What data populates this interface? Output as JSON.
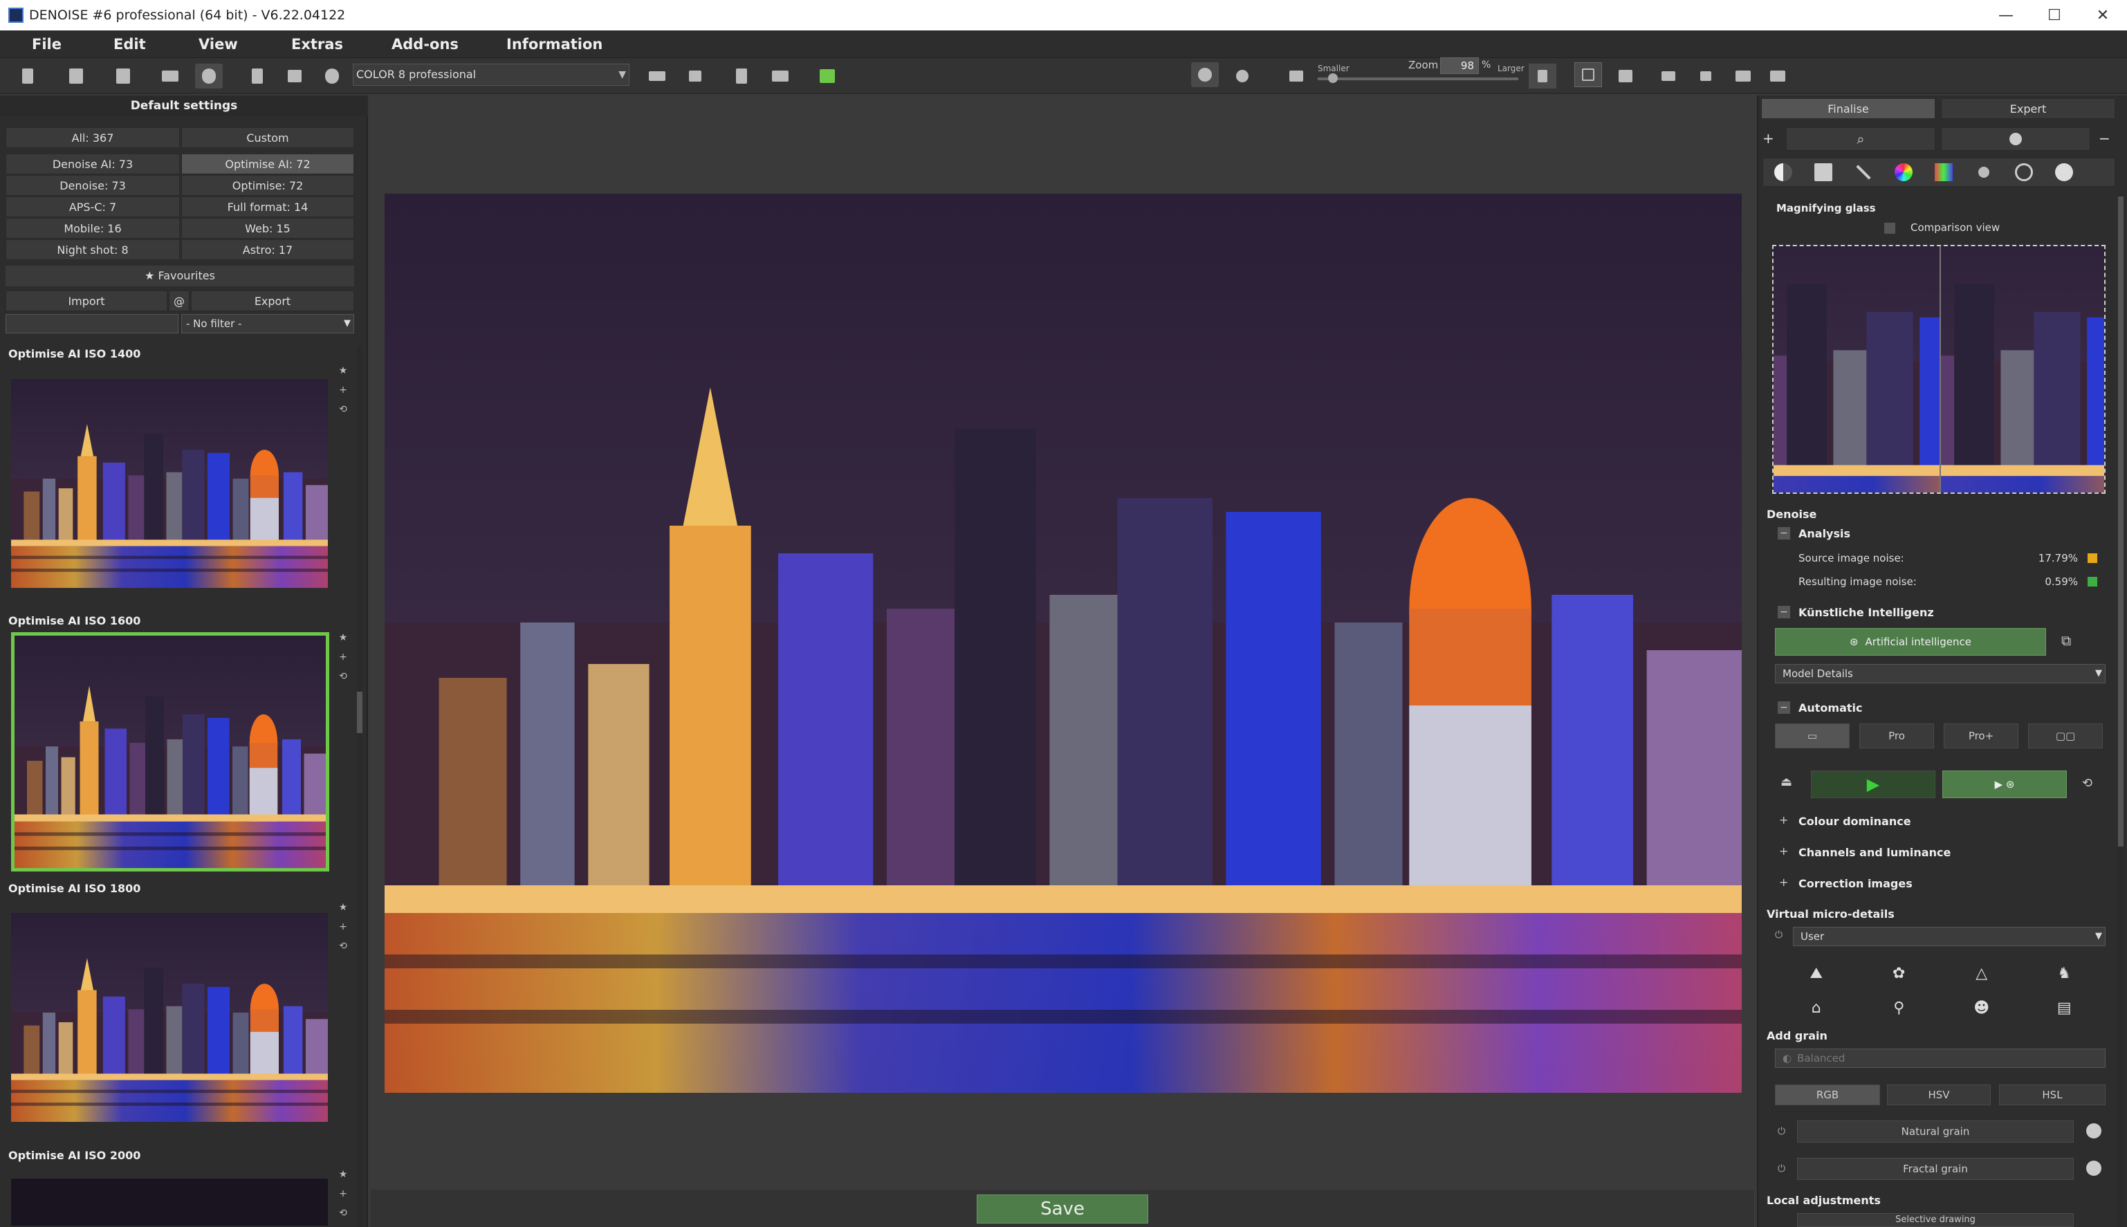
{
  "window": {
    "title": "DENOISE #6 professional (64 bit) - V6.22.04122",
    "controls": [
      "—",
      "☐",
      "✕"
    ]
  },
  "menu": [
    "File",
    "Edit",
    "View",
    "Extras",
    "Add-ons",
    "Information"
  ],
  "toolbar": {
    "preset": "COLOR 8 professional",
    "zoom_label": "Zoom",
    "zoom_value": "98",
    "zoom_unit": "%",
    "smaller": "Smaller",
    "larger": "Larger",
    "zoom_slider_level": 0.05
  },
  "left_panel": {
    "title": "Default settings",
    "tabs": [
      "All: 367",
      "Custom"
    ],
    "categories": [
      [
        "Denoise AI: 73",
        "Optimise AI: 72"
      ],
      [
        "Denoise: 73",
        "Optimise: 72"
      ],
      [
        "APS-C: 7",
        "Full format: 14"
      ],
      [
        "Mobile: 16",
        "Web: 15"
      ],
      [
        "Night shot: 8",
        "Astro: 17"
      ]
    ],
    "favourites": "★ Favourites",
    "import": "Import",
    "at": "@",
    "export": "Export",
    "filter": "- No filter -",
    "presets": [
      {
        "title": "Optimise AI ISO 1400",
        "selected": false
      },
      {
        "title": "Optimise AI ISO 1600",
        "selected": true
      },
      {
        "title": "Optimise AI ISO 1800",
        "selected": false
      },
      {
        "title": "Optimise AI ISO 2000",
        "selected": false
      }
    ]
  },
  "main": {
    "save": "Save"
  },
  "right_panel": {
    "tabs": [
      "Finalise",
      "Expert"
    ],
    "plus": "+",
    "minus": "−",
    "magnifier": {
      "title": "Magnifying glass",
      "comparison": "Comparison view"
    },
    "denoise": {
      "title": "Denoise",
      "analysis": "Analysis",
      "source_label": "Source image noise:",
      "source_value": "17.79%",
      "result_label": "Resulting image noise:",
      "result_value": "0.59%",
      "ki": "Künstliche Intelligenz",
      "ai_button": "Artificial intelligence",
      "model": "Model Details",
      "automatic": "Automatic",
      "auto_buttons": [
        "▭",
        "Pro",
        "Pro+",
        "▢▢"
      ],
      "colour_dominance": "Colour dominance",
      "channels": "Channels and luminance",
      "correction": "Correction images"
    },
    "micro": {
      "title": "Virtual micro-details",
      "preset": "User"
    },
    "grain": {
      "title": "Add grain",
      "preset": "Balanced",
      "modes": [
        "RGB",
        "HSV",
        "HSL"
      ],
      "natural": "Natural grain",
      "fractal": "Fractal grain"
    },
    "local": {
      "title": "Local adjustments",
      "selective": "Selective drawing"
    }
  },
  "colors": {
    "accent_green": "#6fc84a",
    "save_green": "#4e7d4a",
    "source_noise": "#e6a817",
    "result_noise": "#3cb043"
  }
}
